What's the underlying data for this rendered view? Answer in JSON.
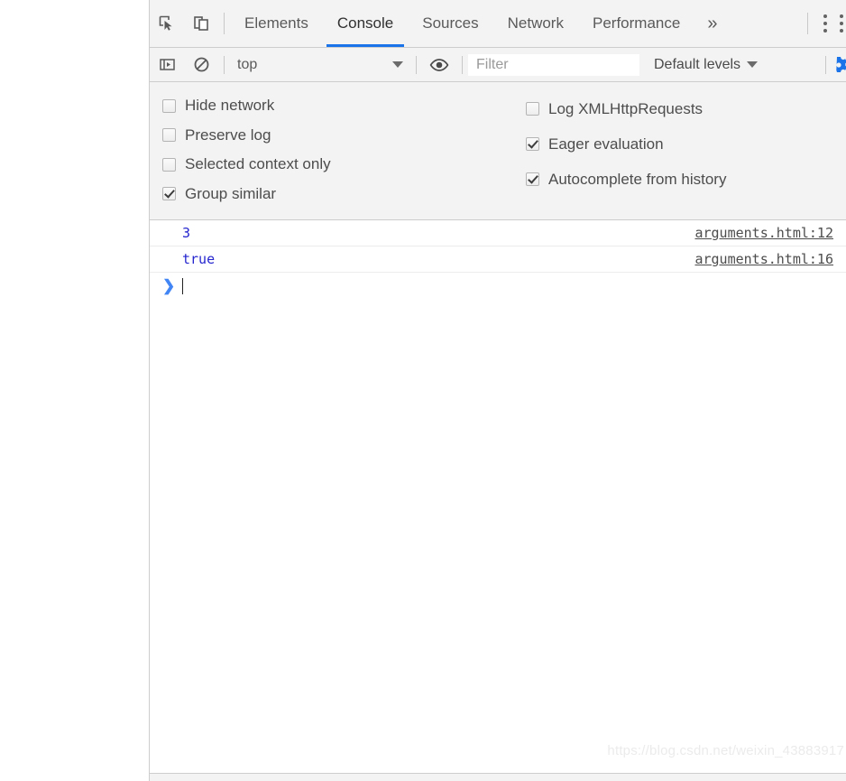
{
  "tabbar": {
    "inspect_icon": "inspect-element-icon",
    "device_icon": "device-toolbar-icon",
    "tabs": [
      {
        "label": "Elements",
        "active": false
      },
      {
        "label": "Console",
        "active": true
      },
      {
        "label": "Sources",
        "active": false
      },
      {
        "label": "Network",
        "active": false
      },
      {
        "label": "Performance",
        "active": false
      }
    ],
    "more_tabs": "»",
    "menu_icon": "more-options-icon"
  },
  "filterbar": {
    "sidebar_icon": "console-sidebar-icon",
    "clear_icon": "clear-console-icon",
    "context": "top",
    "eye_icon": "live-expression-icon",
    "filter_placeholder": "Filter",
    "levels_label": "Default levels",
    "settings_icon": "settings-gear-icon",
    "accent": "#1a73e8"
  },
  "settings": {
    "left": [
      {
        "label": "Hide network",
        "checked": false
      },
      {
        "label": "Preserve log",
        "checked": false
      },
      {
        "label": "Selected context only",
        "checked": false
      },
      {
        "label": "Group similar",
        "checked": true
      }
    ],
    "right": [
      {
        "label": "Log XMLHttpRequests",
        "checked": false
      },
      {
        "label": "Eager evaluation",
        "checked": true
      },
      {
        "label": "Autocomplete from history",
        "checked": true
      }
    ]
  },
  "console": {
    "messages": [
      {
        "value": "3",
        "source": "arguments.html:12"
      },
      {
        "value": "true",
        "source": "arguments.html:16"
      }
    ],
    "prompt_chevron": "❯",
    "value_color": "#2626cf"
  },
  "watermark": "https://blog.csdn.net/weixin_43883917",
  "statusbar": {
    "text": ""
  }
}
